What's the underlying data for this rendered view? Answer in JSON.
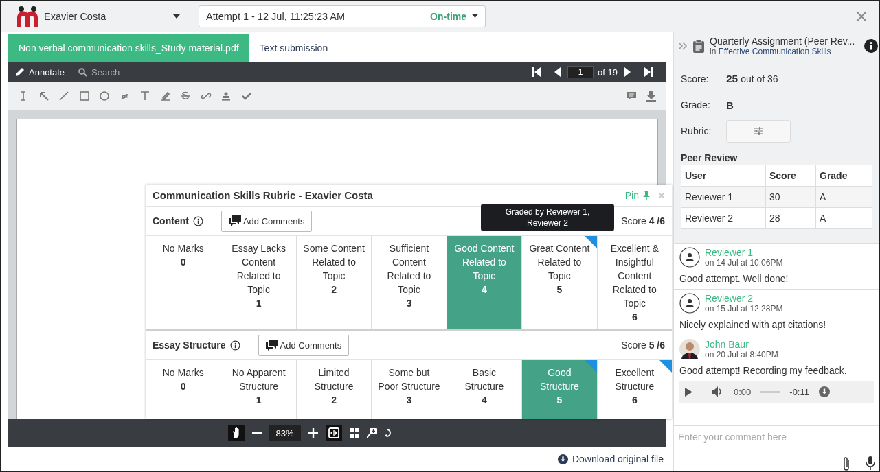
{
  "header": {
    "user_name": "Exavier Costa",
    "attempt": {
      "label": "Attempt 1 - 12 Jul, 11:25:23 AM",
      "status": "On-time"
    }
  },
  "tabs": [
    {
      "label": "Non verbal communication skills_Study material.pdf",
      "selected": true
    },
    {
      "label": "Text submission",
      "selected": false
    }
  ],
  "viewer": {
    "annotate": "Annotate",
    "search": "Search",
    "page": "1",
    "page_total": "of 19",
    "zoom": "83%",
    "download": "Download original file"
  },
  "rubric": {
    "title": "Communication Skills Rubric - Exavier Costa",
    "pin": "Pin",
    "tooltip": "Graded by Reviewer 1, Reviewer 2",
    "criteria": [
      {
        "name": "Content",
        "add_comments": "Add Comments",
        "score": "Score **4 /6**",
        "levels": [
          {
            "title": "No Marks",
            "points": "0",
            "selected": false,
            "peer_marked": false
          },
          {
            "title": "Essay Lacks Content Related to Topic",
            "points": "1",
            "selected": false,
            "peer_marked": false
          },
          {
            "title": "Some Content Related to Topic",
            "points": "2",
            "selected": false,
            "peer_marked": false
          },
          {
            "title": "Sufficient Content Related to Topic",
            "points": "3",
            "selected": false,
            "peer_marked": false
          },
          {
            "title": "Good Content Related to Topic",
            "points": "4",
            "selected": true,
            "peer_marked": false
          },
          {
            "title": "Great Content Related to Topic",
            "points": "5",
            "selected": false,
            "peer_marked": true
          },
          {
            "title": "Excellent & Insightful Content Related to Topic",
            "points": "6",
            "selected": false,
            "peer_marked": false
          }
        ]
      },
      {
        "name": "Essay Structure",
        "add_comments": "Add Comments",
        "score": "Score **5 /6**",
        "levels": [
          {
            "title": "No Marks",
            "points": "0",
            "selected": false,
            "peer_marked": false
          },
          {
            "title": "No Apparent Structure",
            "points": "1",
            "selected": false,
            "peer_marked": false
          },
          {
            "title": "Limited Structure",
            "points": "2",
            "selected": false,
            "peer_marked": false
          },
          {
            "title": "Some but Poor Structure",
            "points": "3",
            "selected": false,
            "peer_marked": false
          },
          {
            "title": "Basic Structure",
            "points": "4",
            "selected": false,
            "peer_marked": false
          },
          {
            "title": "Good Structure",
            "points": "5",
            "selected": true,
            "peer_marked": true
          },
          {
            "title": "Excellent Structure",
            "points": "6",
            "selected": false,
            "peer_marked": true
          }
        ]
      }
    ]
  },
  "panel": {
    "title": "Quarterly Assignment (Peer Rev...",
    "course_prefix": "in",
    "course": "Effective Communication Skills",
    "score_label": "Score:",
    "score": "**25** out of 36",
    "grade_label": "Grade:",
    "grade": "B",
    "rubric_label": "Rubric:",
    "peer_review": {
      "title": "Peer Review",
      "columns": [
        "User",
        "Score",
        "Grade"
      ],
      "rows": [
        [
          "Reviewer 1",
          "30",
          "A"
        ],
        [
          "Reviewer 2",
          "28",
          "A"
        ]
      ]
    },
    "comments": [
      {
        "author": "Reviewer 1",
        "date": "on 14 Jul at 10:06PM",
        "text": "Good attempt. Well done!",
        "kind": "default"
      },
      {
        "author": "Reviewer 2",
        "date": "on 15 Jul at 12:28PM",
        "text": "Nicely explained with apt citations!",
        "kind": "default"
      },
      {
        "author": "John Baur",
        "date": "on 20 Jul at 8:40PM",
        "text": "Good attempt! Recording my feedback.",
        "kind": "photo",
        "audio": {
          "time": "0:00",
          "remaining": "-0:11"
        }
      }
    ],
    "comment_placeholder": "Enter your comment here"
  }
}
